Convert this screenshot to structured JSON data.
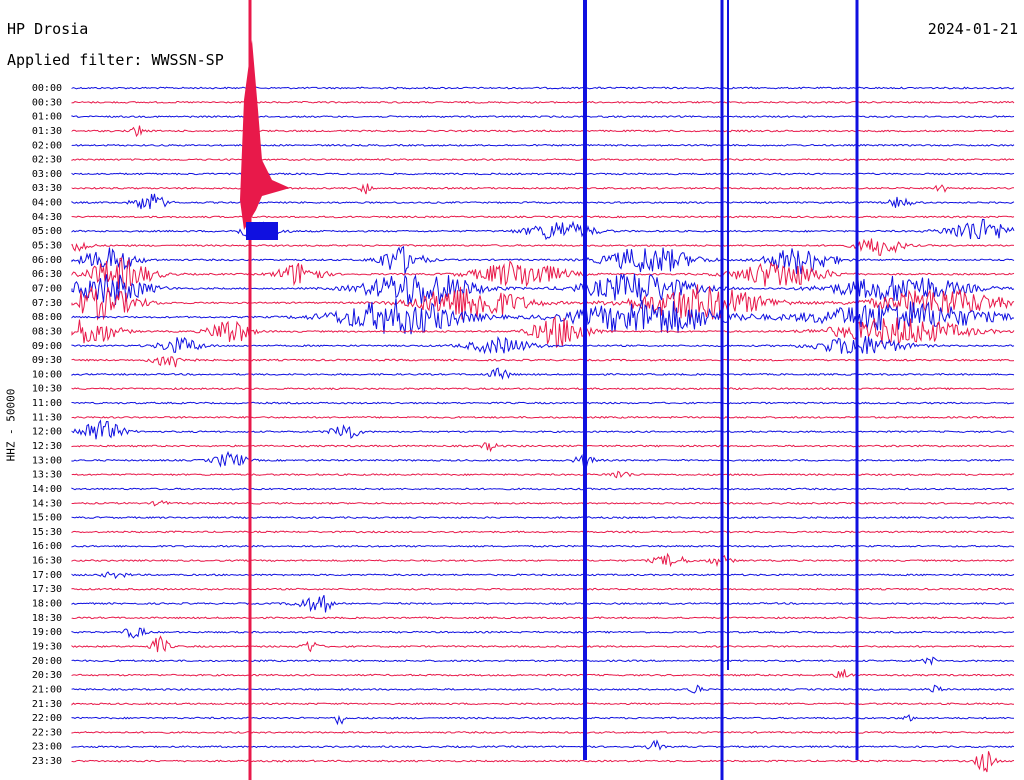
{
  "header": {
    "station": "HP Drosia",
    "date": "2024-01-21",
    "filter": "Applied filter: WWSSN-SP"
  },
  "chart_data": {
    "type": "line",
    "title": "HP Drosia",
    "ylabel": "HHZ - 50000",
    "row_labels": [
      "00:00",
      "00:30",
      "01:00",
      "01:30",
      "02:00",
      "02:30",
      "03:00",
      "03:30",
      "04:00",
      "04:30",
      "05:00",
      "05:30",
      "06:00",
      "06:30",
      "07:00",
      "07:30",
      "08:00",
      "08:30",
      "09:00",
      "09:30",
      "10:00",
      "10:30",
      "11:00",
      "11:30",
      "12:00",
      "12:30",
      "13:00",
      "13:30",
      "14:00",
      "14:30",
      "15:00",
      "15:30",
      "16:00",
      "16:30",
      "17:00",
      "17:30",
      "18:00",
      "18:30",
      "19:00",
      "19:30",
      "20:00",
      "20:30",
      "21:00",
      "21:30",
      "22:00",
      "22:30",
      "23:00",
      "23:30"
    ],
    "row_minutes": 30,
    "colors": {
      "odd_rows": "#e8194a",
      "even_rows": "#1010e0",
      "background": "#ffffff"
    },
    "alternating_colors": [
      "#1010e0",
      "#e8194a"
    ],
    "grid": false
  }
}
